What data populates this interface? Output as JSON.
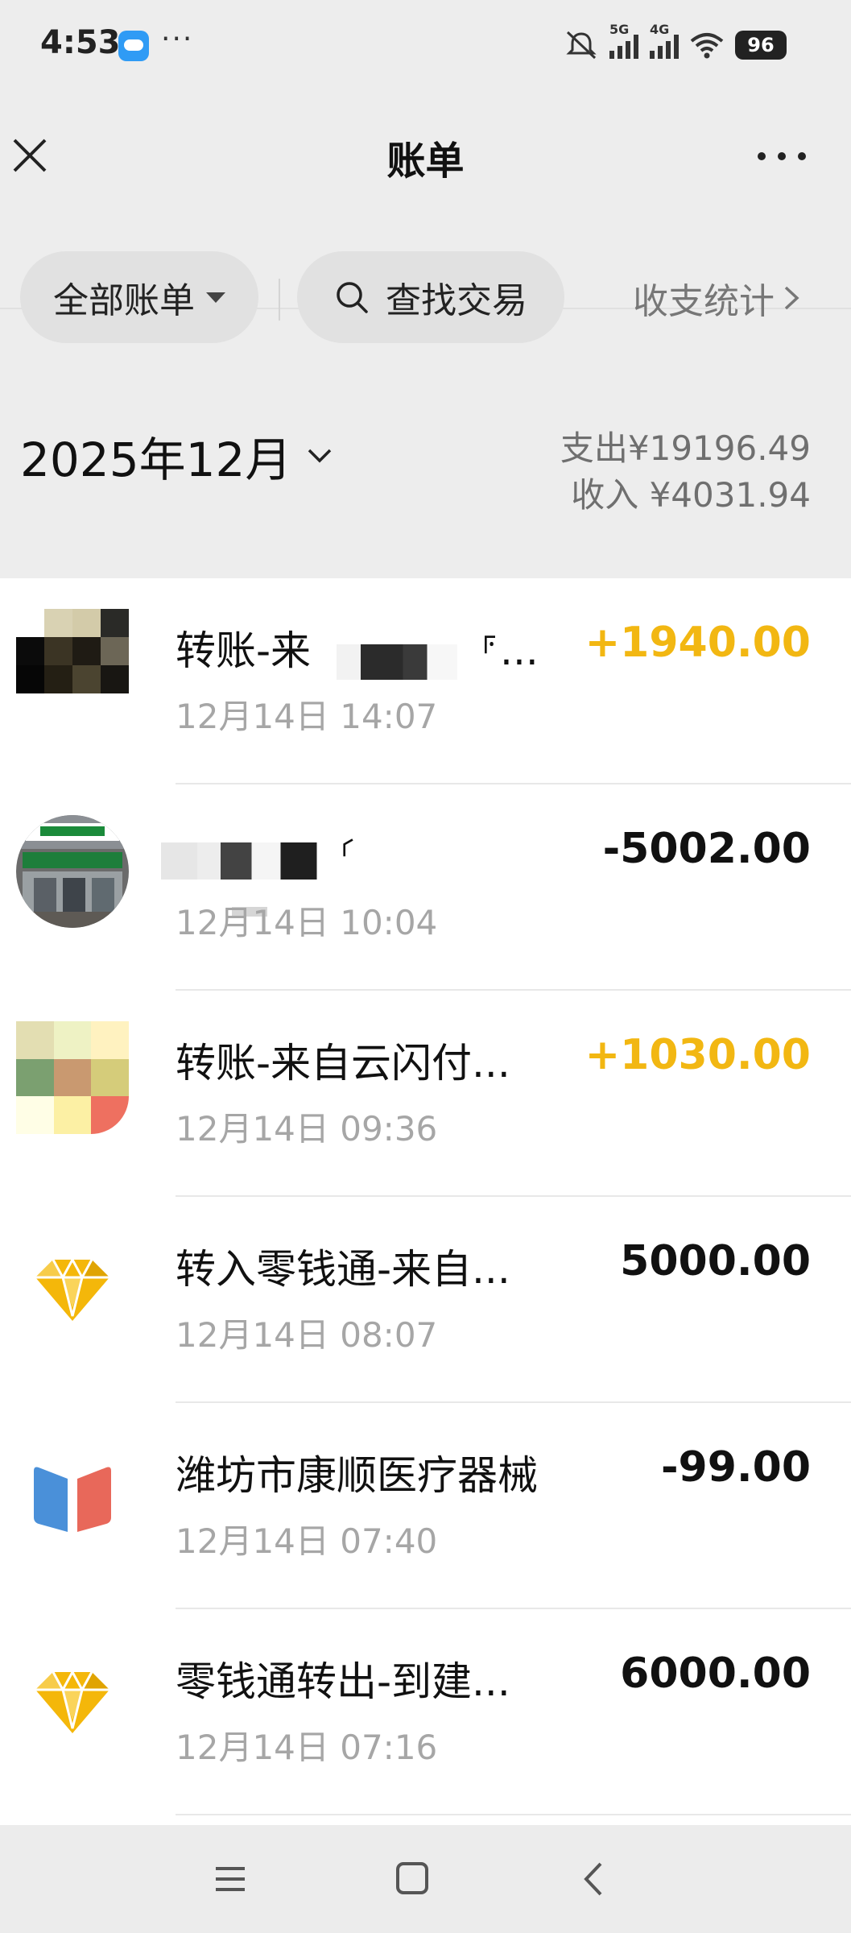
{
  "status_bar": {
    "time": "4:53",
    "dots": "···",
    "net1": "5G",
    "net2": "4G",
    "battery": "96"
  },
  "header": {
    "title": "账单"
  },
  "filters": {
    "all_bills": "全部账单",
    "search": "查找交易",
    "stats": "收支统计"
  },
  "summary": {
    "month": "2025年12月",
    "expense": "支出¥19196.49",
    "income": "收入 ¥4031.94"
  },
  "transactions": [
    {
      "title": "转账-来",
      "title_suffix": "⸁...",
      "time": "12月14日 14:07",
      "amount": "+1940.00",
      "type": "income",
      "icon": "transfer-avatar-icon"
    },
    {
      "title": "",
      "title_suffix": "⸂",
      "time": "12月14日 10:04",
      "amount": "-5002.00",
      "type": "expense",
      "icon": "store-photo-avatar"
    },
    {
      "title": "转账-来自云闪付...",
      "title_suffix": "",
      "time": "12月14日 09:36",
      "amount": "+1030.00",
      "type": "income",
      "icon": "mosaic-avatar"
    },
    {
      "title": "转入零钱通-来自...",
      "title_suffix": "",
      "time": "12月14日 08:07",
      "amount": "5000.00",
      "type": "neutral",
      "icon": "diamond-icon"
    },
    {
      "title": "潍坊市康顺医疗器械",
      "title_suffix": "",
      "time": "12月14日 07:40",
      "amount": "-99.00",
      "type": "expense",
      "icon": "merchant-book-icon"
    },
    {
      "title": "零钱通转出-到建...",
      "title_suffix": "",
      "time": "12月14日 07:16",
      "amount": "6000.00",
      "type": "neutral",
      "icon": "diamond-icon"
    }
  ],
  "colors": {
    "income": "#f2b712",
    "expense": "#111111",
    "secondary": "#a6a6a6",
    "background": "#ededed"
  },
  "nav": {
    "menu": "menu-icon",
    "home": "home-icon",
    "back": "back-icon"
  }
}
